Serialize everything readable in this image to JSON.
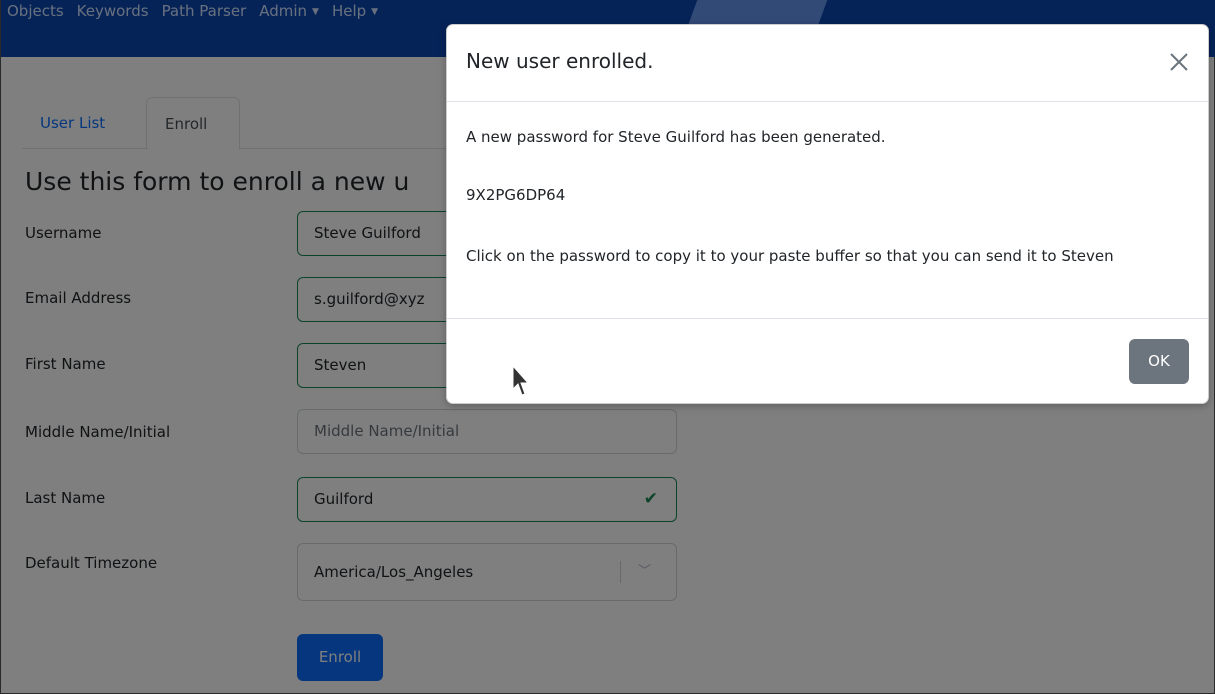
{
  "navbar": {
    "items": [
      {
        "label": "Objects"
      },
      {
        "label": "Keywords"
      },
      {
        "label": "Path Parser"
      },
      {
        "label": "Admin"
      },
      {
        "label": "Help"
      }
    ]
  },
  "tabs": {
    "user_list": "User List",
    "enroll": "Enroll"
  },
  "form": {
    "heading": "Use this form to enroll a new u",
    "fields": {
      "username": {
        "label": "Username",
        "value": "Steve Guilford"
      },
      "email": {
        "label": "Email Address",
        "value": "s.guilford@xyz"
      },
      "first_name": {
        "label": "First Name",
        "value": "Steven"
      },
      "middle_name": {
        "label": "Middle Name/Initial",
        "value": "",
        "placeholder": "Middle Name/Initial"
      },
      "last_name": {
        "label": "Last Name",
        "value": "Guilford"
      },
      "timezone": {
        "label": "Default Timezone",
        "value": "America/Los_Angeles"
      }
    },
    "enroll_label": "Enroll"
  },
  "modal": {
    "title": "New user enrolled.",
    "message": "A new password for Steve Guilford has been generated.",
    "password": "9X2PG6DP64",
    "instruction": "Click on the password to copy it to your paste buffer so that you can send it to Steven",
    "ok_label": "OK"
  },
  "colors": {
    "navbar": "#0d47b0",
    "primary": "#0d6efd",
    "valid": "#198754",
    "secondary_button": "#6c757d"
  },
  "icons": {
    "close": "close-icon",
    "check": "check-icon",
    "chevron": "chevron-down-icon",
    "cursor": "mouse-cursor-icon"
  }
}
